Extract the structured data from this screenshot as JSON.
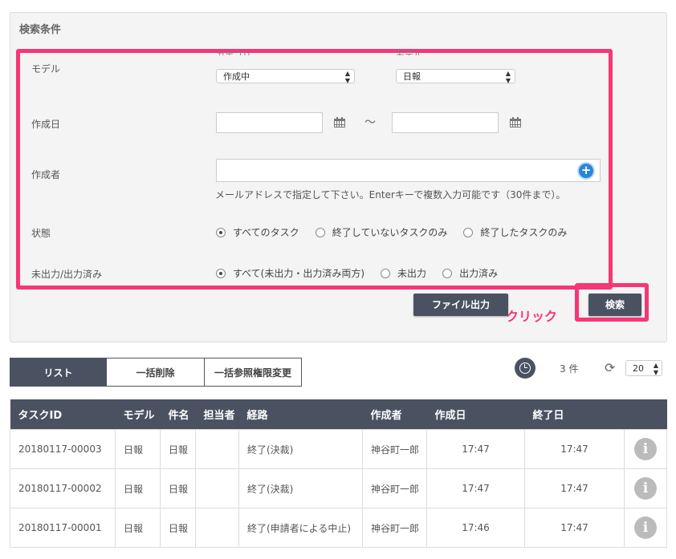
{
  "search_panel": {
    "title": "検索条件",
    "model_label": "モデル",
    "category_header": "カテゴリ",
    "model_header": "モデル",
    "category_value": "作成中",
    "model_value": "日報",
    "date_label": "作成日",
    "date_from": "",
    "date_to": "",
    "tilde": "～",
    "author_label": "作成者",
    "author_value": "",
    "author_hint": "メールアドレスで指定して下さい。Enterキーで複数入力可能です（30件まで）。",
    "status_label": "状態",
    "status_options": [
      "すべてのタスク",
      "終了していないタスクのみ",
      "終了したタスクのみ"
    ],
    "status_selected": 0,
    "output_label": "未出力/出力済み",
    "output_options": [
      "すべて(未出力・出力済み両方)",
      "未出力",
      "出力済み"
    ],
    "output_selected": 0,
    "file_output_button": "ファイル出力",
    "search_button": "検索",
    "click_annotation": "クリック"
  },
  "tabs": [
    "リスト",
    "一括削除",
    "一括参照権限変更"
  ],
  "active_tab": 0,
  "result_count": "3 件",
  "per_page": "20",
  "table": {
    "headers": [
      "タスクID",
      "モデル",
      "件名",
      "担当者",
      "経路",
      "作成者",
      "作成日",
      "終了日",
      ""
    ],
    "rows": [
      [
        "20180117-00003",
        "日報",
        "日報",
        "",
        "終了(決裁)",
        "神谷町一郎",
        "17:47",
        "17:47"
      ],
      [
        "20180117-00002",
        "日報",
        "日報",
        "",
        "終了(決裁)",
        "神谷町一郎",
        "17:47",
        "17:47"
      ],
      [
        "20180117-00001",
        "日報",
        "日報",
        "",
        "終了(申請者による中止)",
        "神谷町一郎",
        "17:46",
        "17:47"
      ]
    ]
  },
  "colors": {
    "accent": "#f73674",
    "dark": "#4a5262",
    "info": "#bbbbbb"
  }
}
